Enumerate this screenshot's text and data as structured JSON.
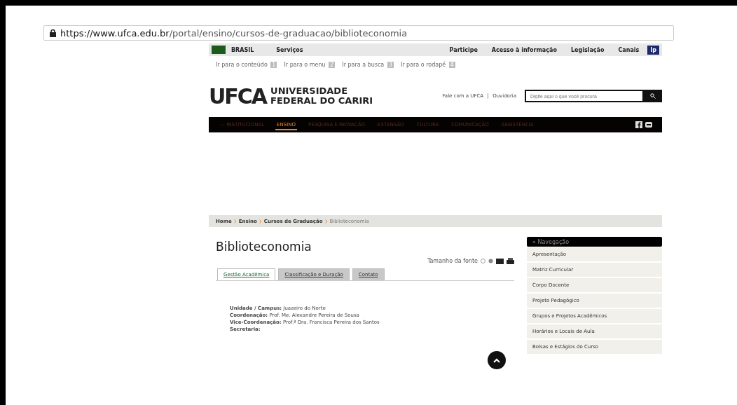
{
  "address_bar": {
    "host": "https://www.ufca.edu.br",
    "path": "/portal/ensino/cursos-de-graduacao/biblioteconomia"
  },
  "gov_bar": {
    "brand": "BRASIL",
    "left_links": [
      "Serviços"
    ],
    "right_links": [
      "Participe",
      "Acesso à informação",
      "Legislação",
      "Canais"
    ],
    "lang": "Ip"
  },
  "accessibility_links": [
    {
      "label": "Ir para o conteúdo",
      "key": "1"
    },
    {
      "label": "Ir para o menu",
      "key": "2"
    },
    {
      "label": "Ir para a busca",
      "key": "3"
    },
    {
      "label": "Ir para o rodapé",
      "key": "4"
    }
  ],
  "header": {
    "logo": "UFCA",
    "name_lines": [
      "UNIVERSIDADE",
      "FEDERAL DO CARIRI"
    ],
    "links": [
      "Fale com a UFCA",
      "Ouvidoria"
    ],
    "search": {
      "placeholder": "Digite aqui o que você procura"
    }
  },
  "main_menu": [
    {
      "label": "— INSTITUCIONAL",
      "selected": false
    },
    {
      "label": "ENSINO",
      "selected": true
    },
    {
      "label": "PESQUISA E INOVAÇÃO",
      "selected": false
    },
    {
      "label": "EXTENSÃO",
      "selected": false
    },
    {
      "label": "CULTURA",
      "selected": false
    },
    {
      "label": "COMUNICAÇÃO",
      "selected": false
    },
    {
      "label": "ASSISTÊNCIA",
      "selected": false
    }
  ],
  "breadcrumb": [
    "Home",
    "Ensino",
    "Cursos de Graduação",
    "Biblioteconomia"
  ],
  "page_title": "Biblioteconomia",
  "font_size_label": "Tamanho da fonte",
  "tabs": [
    {
      "label": "Gestão Acadêmica",
      "selected": true
    },
    {
      "label": "Classificação e Duração",
      "selected": false
    },
    {
      "label": "Contato",
      "selected": false
    }
  ],
  "info": [
    {
      "label": "Unidade / Campus:",
      "value": "Juazeiro do Norte"
    },
    {
      "label": "Coordenação:",
      "value": "Prof. Me. Alexandre Pereira de Sousa"
    },
    {
      "label": "Vice-Coordenação:",
      "value": "Prof.ª Dra. Francisca Pereira dos Santos"
    },
    {
      "label": "Secretaria:"
    }
  ],
  "sidebar": {
    "title": "» Navegação",
    "items": [
      "Apresentação",
      "Matriz Curricular",
      "Corpo Docente",
      "Projeto Pedagógico",
      "Grupos e Projetos Acadêmicos",
      "Horários e Locais de Aula",
      "Bolsas e Estágios do Curso"
    ]
  }
}
